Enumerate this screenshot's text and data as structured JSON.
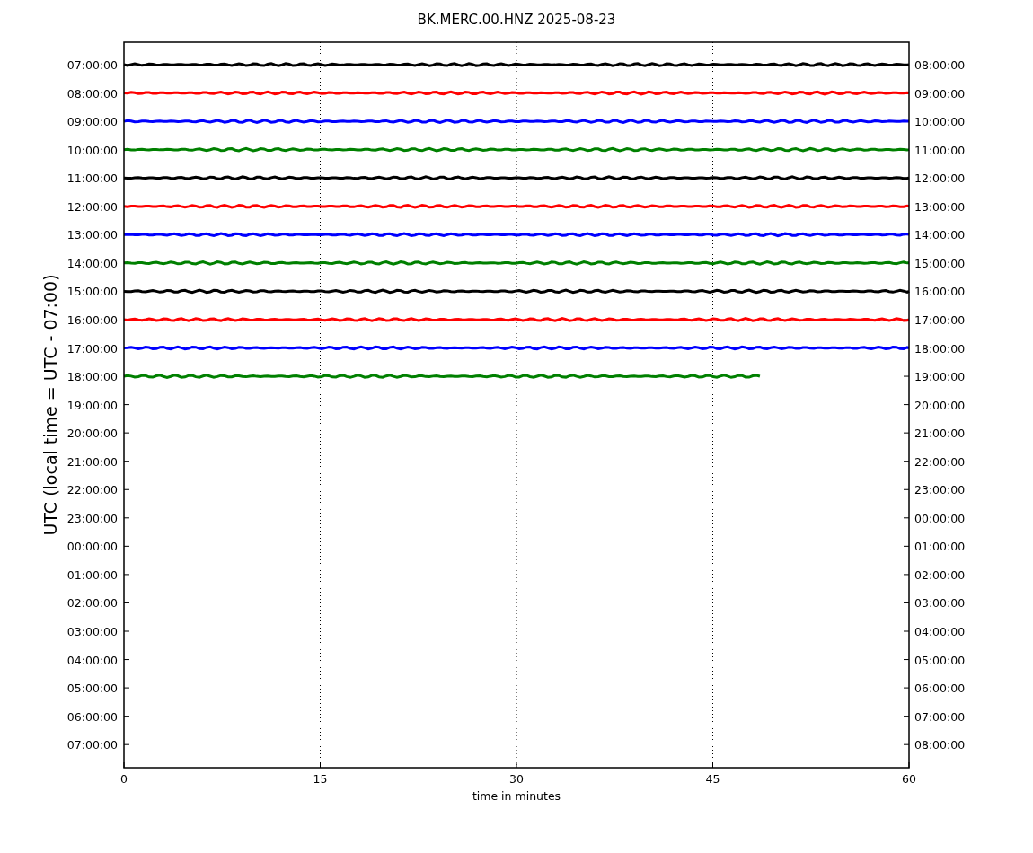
{
  "title": "BK.MERC.00.HNZ 2025-08-23",
  "ylabel": "UTC (local time = UTC - 07:00)",
  "xlabel": "time in minutes",
  "xticks": [
    "0",
    "15",
    "30",
    "45",
    "60"
  ],
  "left_labels": [
    "07:00:00",
    "08:00:00",
    "09:00:00",
    "10:00:00",
    "11:00:00",
    "12:00:00",
    "13:00:00",
    "14:00:00",
    "15:00:00",
    "16:00:00",
    "17:00:00",
    "18:00:00",
    "19:00:00",
    "20:00:00",
    "21:00:00",
    "22:00:00",
    "23:00:00",
    "00:00:00",
    "01:00:00",
    "02:00:00",
    "03:00:00",
    "04:00:00",
    "05:00:00",
    "06:00:00",
    "07:00:00"
  ],
  "right_labels": [
    "08:00:00",
    "09:00:00",
    "10:00:00",
    "11:00:00",
    "12:00:00",
    "13:00:00",
    "14:00:00",
    "15:00:00",
    "16:00:00",
    "17:00:00",
    "18:00:00",
    "19:00:00",
    "20:00:00",
    "21:00:00",
    "22:00:00",
    "23:00:00",
    "00:00:00",
    "01:00:00",
    "02:00:00",
    "03:00:00",
    "04:00:00",
    "05:00:00",
    "06:00:00",
    "07:00:00",
    "08:00:00"
  ],
  "traces": [
    {
      "color": "#000000",
      "level": 1
    },
    {
      "color": "#ff0000",
      "level": 1
    },
    {
      "color": "#0000ff",
      "level": 1
    },
    {
      "color": "#008000",
      "level": 1
    },
    {
      "color": "#000000",
      "level": 1
    },
    {
      "color": "#ff0000",
      "level": 1
    },
    {
      "color": "#0000ff",
      "level": 1
    },
    {
      "color": "#008000",
      "level": 1
    },
    {
      "color": "#000000",
      "level": 1
    },
    {
      "color": "#ff0000",
      "level": 1
    },
    {
      "color": "#0000ff",
      "level": 1
    },
    {
      "color": "#008000",
      "level": 0.81
    }
  ]
}
